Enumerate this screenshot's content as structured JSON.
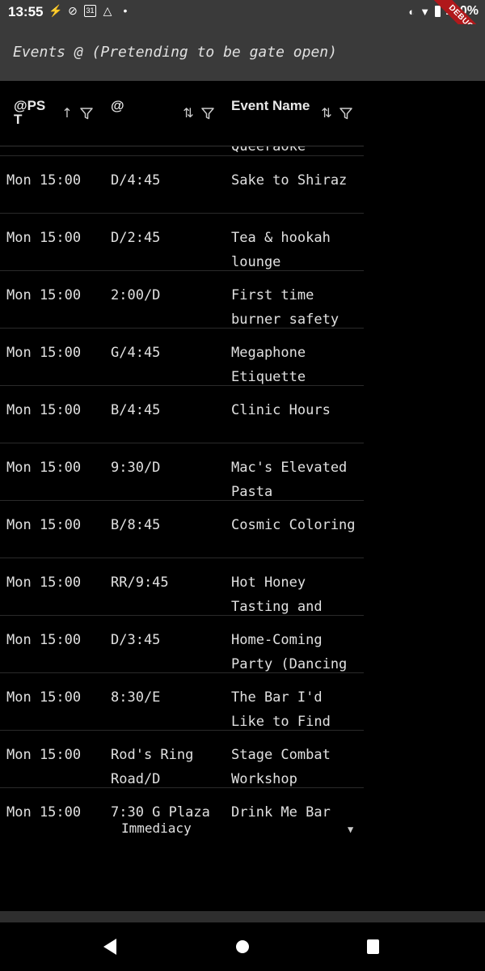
{
  "status_bar": {
    "time": "13:55",
    "icons": [
      "flutter-icon",
      "check-circle-icon",
      "calendar-icon",
      "drive-icon",
      "dot-icon"
    ],
    "battery": "100%"
  },
  "debug_banner": "DEBUG",
  "app_bar": {
    "title": "Events @ (Pretending to be gate open)"
  },
  "table": {
    "columns": [
      {
        "label": "@PST",
        "sort_icon": "↑",
        "filter_icon": "filter"
      },
      {
        "label": "@",
        "sort_icon": "⇅",
        "filter_icon": "filter"
      },
      {
        "label": "Event Name",
        "sort_icon": "⇅",
        "filter_icon": "filter"
      }
    ],
    "partial_row": {
      "name": "Queeraoke"
    },
    "rows": [
      {
        "time": "Mon 15:00",
        "loc": "D/4:45",
        "name": "Sake to Shiraz"
      },
      {
        "time": "Mon 15:00",
        "loc": "D/2:45",
        "name": "Tea & hookah lounge"
      },
      {
        "time": "Mon 15:00",
        "loc": "2:00/D",
        "name": "First time burner safety"
      },
      {
        "time": "Mon 15:00",
        "loc": "G/4:45",
        "name": "Megaphone Etiquette"
      },
      {
        "time": "Mon 15:00",
        "loc": "B/4:45",
        "name": "Clinic Hours"
      },
      {
        "time": "Mon 15:00",
        "loc": "9:30/D",
        "name": "Mac's Elevated Pasta"
      },
      {
        "time": "Mon 15:00",
        "loc": "B/8:45",
        "name": "Cosmic Coloring"
      },
      {
        "time": "Mon 15:00",
        "loc": "RR/9:45",
        "name": "Hot Honey Tasting and"
      },
      {
        "time": "Mon 15:00",
        "loc": "D/3:45",
        "name": "Home-Coming Party (Dancing"
      },
      {
        "time": "Mon 15:00",
        "loc": "8:30/E",
        "name": "The Bar I'd Like to Find"
      },
      {
        "time": "Mon 15:00",
        "loc": "Rod's Ring Road/D",
        "name": "Stage Combat Workshop"
      }
    ],
    "last_row": {
      "time": "Mon 15:00",
      "loc": "7:30 G Plaza",
      "name": "Drink Me Bar"
    }
  },
  "footer": {
    "selected": "Immediacy"
  }
}
